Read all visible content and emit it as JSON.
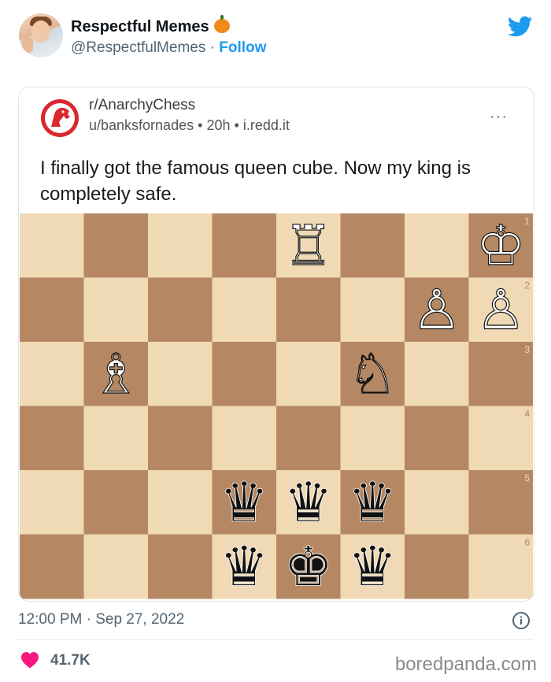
{
  "tweet": {
    "author_name": "Respectful Memes",
    "author_emoji": "pumpkin-icon",
    "handle": "@RespectfulMemes",
    "separator": "·",
    "follow_label": "Follow",
    "timestamp": "12:00 PM · Sep 27, 2022",
    "likes": "41.7K"
  },
  "reddit_post": {
    "subreddit": "r/AnarchyChess",
    "author": "u/banksfornades",
    "age": "20h",
    "domain": "i.redd.it",
    "dot": "•",
    "more": "···",
    "title": "I finally got the famous queen cube. Now my king is completely safe."
  },
  "chess_board": {
    "light_color": "#f0d9b5",
    "dark_color": "#b58863",
    "rank_labels": [
      "1",
      "2",
      "3",
      "4",
      "5",
      "6"
    ],
    "pieces": [
      {
        "glyph": "♖",
        "file": 5,
        "rank": 1,
        "color": "white",
        "name": "white-rook"
      },
      {
        "glyph": "♔",
        "file": 8,
        "rank": 1,
        "color": "white",
        "name": "white-king"
      },
      {
        "glyph": "♙",
        "file": 7,
        "rank": 2,
        "color": "white",
        "name": "white-pawn"
      },
      {
        "glyph": "♙",
        "file": 8,
        "rank": 2,
        "color": "white",
        "name": "white-pawn"
      },
      {
        "glyph": "♗",
        "file": 2,
        "rank": 3,
        "color": "white",
        "name": "white-bishop"
      },
      {
        "glyph": "♘",
        "file": 6,
        "rank": 3,
        "color": "white",
        "name": "white-knight"
      },
      {
        "glyph": "♛",
        "file": 4,
        "rank": 5,
        "color": "black",
        "name": "black-queen"
      },
      {
        "glyph": "♛",
        "file": 5,
        "rank": 5,
        "color": "black",
        "name": "black-queen"
      },
      {
        "glyph": "♛",
        "file": 6,
        "rank": 5,
        "color": "black",
        "name": "black-queen"
      },
      {
        "glyph": "♛",
        "file": 4,
        "rank": 6,
        "color": "black",
        "name": "black-queen"
      },
      {
        "glyph": "♚",
        "file": 5,
        "rank": 6,
        "color": "black",
        "name": "black-king"
      },
      {
        "glyph": "♛",
        "file": 6,
        "rank": 6,
        "color": "black",
        "name": "black-queen"
      }
    ]
  },
  "watermark": "boredpanda.com",
  "colors": {
    "twitter_blue": "#1d9bf0",
    "heart": "#f91880",
    "reddit_red": "#d9282f"
  }
}
